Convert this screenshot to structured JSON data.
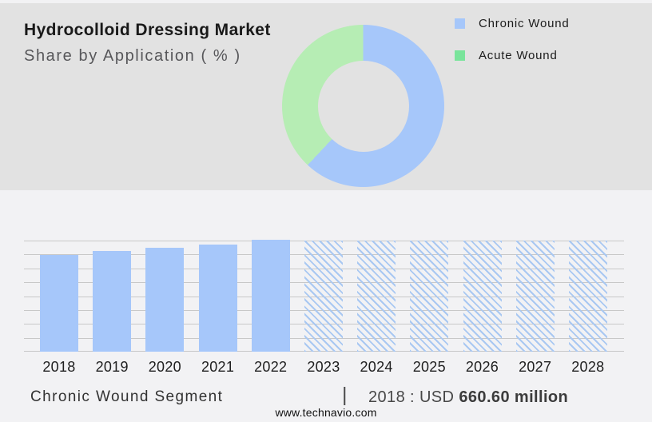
{
  "header": {
    "title": "Hydrocolloid Dressing Market",
    "subtitle": "Share by Application ( % )"
  },
  "legend": {
    "items": [
      {
        "label": "Chronic Wound",
        "color": "#a6c7fa"
      },
      {
        "label": "Acute Wound",
        "color": "#79e49b"
      }
    ]
  },
  "colors": {
    "top_bg": "#e2e2e2",
    "bottom_bg": "#f2f2f4",
    "bar_blue": "#a6c7fa",
    "hatch_blue": "#a9c8f2",
    "gridline": "#c8c8c8",
    "donut_blue": "#a6c7fa",
    "donut_green": "#b6edb4"
  },
  "footer": {
    "segment_label": "Chronic Wound Segment",
    "separator": "|",
    "stat_prefix": "2018 : USD",
    "stat_value": "660.60 million",
    "website": "www.technavio.com"
  },
  "chart_data": [
    {
      "type": "pie",
      "donut": true,
      "title": "Hydrocolloid Dressing Market — Share by Application ( % )",
      "labels": [
        "Chronic Wound",
        "Acute Wound"
      ],
      "values": [
        62,
        38
      ],
      "colors": [
        "#a6c7fa",
        "#b6edb4"
      ],
      "legend_position": "right",
      "start_angle_deg": 0,
      "direction": "clockwise"
    },
    {
      "type": "bar",
      "title": "Chronic Wound Segment size by year (USD million)",
      "categories": [
        "2018",
        "2019",
        "2020",
        "2021",
        "2022",
        "2023",
        "2024",
        "2025",
        "2026",
        "2027",
        "2028"
      ],
      "bars": [
        {
          "year": "2018",
          "height_pct": 87.4,
          "style": "solid"
        },
        {
          "year": "2019",
          "height_pct": 90.6,
          "style": "solid"
        },
        {
          "year": "2020",
          "height_pct": 93.5,
          "style": "solid"
        },
        {
          "year": "2021",
          "height_pct": 96.4,
          "style": "solid"
        },
        {
          "year": "2022",
          "height_pct": 101.0,
          "style": "solid"
        },
        {
          "year": "2023",
          "height_pct": 100.0,
          "style": "hatched"
        },
        {
          "year": "2024",
          "height_pct": 100.0,
          "style": "hatched"
        },
        {
          "year": "2025",
          "height_pct": 100.0,
          "style": "hatched"
        },
        {
          "year": "2026",
          "height_pct": 100.0,
          "style": "hatched"
        },
        {
          "year": "2027",
          "height_pct": 100.0,
          "style": "hatched"
        },
        {
          "year": "2028",
          "height_pct": 100.0,
          "style": "hatched"
        }
      ],
      "values_usd_million_est": {
        "2018": 660.6,
        "2019": 684,
        "2020": 708,
        "2021": 730,
        "2022": 764
      },
      "labeled_value": "2018 : USD 660.60 million",
      "forecast_years_hatched_unlabeled": [
        "2023",
        "2024",
        "2025",
        "2026",
        "2027",
        "2028"
      ],
      "yaxis_labels": "none",
      "gridline_count": 9,
      "grid": true,
      "legend_position": "none"
    }
  ]
}
